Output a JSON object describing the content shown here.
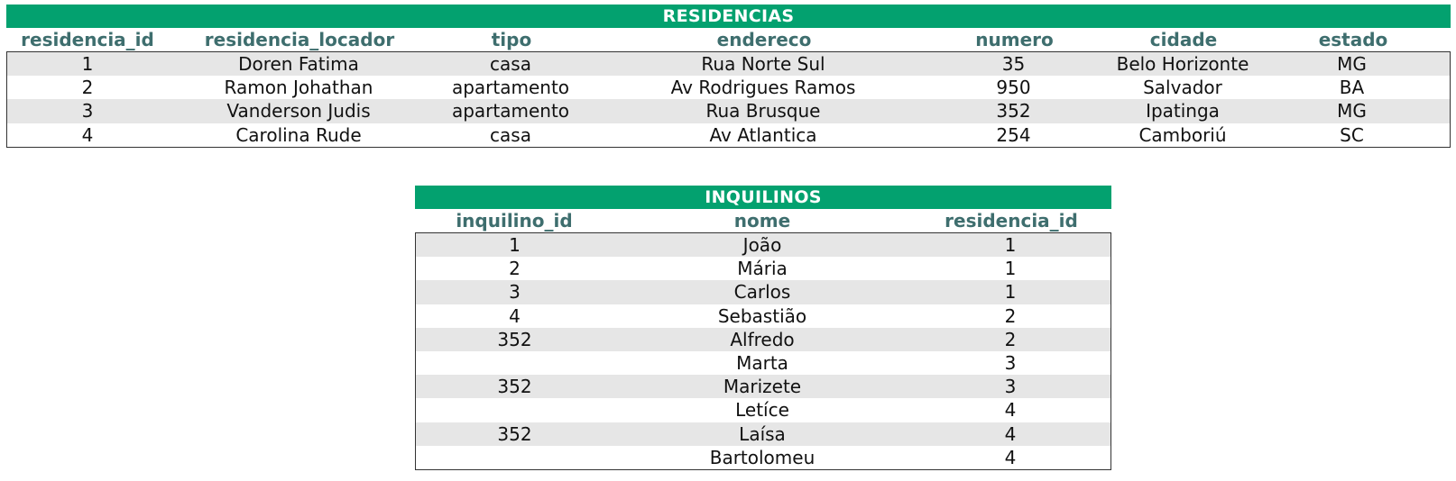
{
  "residencias": {
    "title": "RESIDENCIAS",
    "columns": [
      "residencia_id",
      "residencia_locador",
      "tipo",
      "endereco",
      "numero",
      "cidade",
      "estado"
    ],
    "rows": [
      [
        "1",
        "Doren Fatima",
        "casa",
        "Rua Norte Sul",
        "35",
        "Belo Horizonte",
        "MG"
      ],
      [
        "2",
        "Ramon Johathan",
        "apartamento",
        "Av Rodrigues Ramos",
        "950",
        "Salvador",
        "BA"
      ],
      [
        "3",
        "Vanderson Judis",
        "apartamento",
        "Rua Brusque",
        "352",
        "Ipatinga",
        "MG"
      ],
      [
        "4",
        "Carolina Rude",
        "casa",
        "Av Atlantica",
        "254",
        "Camboriú",
        "SC"
      ]
    ]
  },
  "inquilinos": {
    "title": "INQUILINOS",
    "columns": [
      "inquilino_id",
      "nome",
      "residencia_id"
    ],
    "rows": [
      [
        "1",
        "João",
        "1"
      ],
      [
        "2",
        "Mária",
        "1"
      ],
      [
        "3",
        "Carlos",
        "1"
      ],
      [
        "4",
        "Sebastião",
        "2"
      ],
      [
        "352",
        "Alfredo",
        "2"
      ],
      [
        "",
        "Marta",
        "3"
      ],
      [
        "352",
        "Marizete",
        "3"
      ],
      [
        "",
        "Letíce",
        "4"
      ],
      [
        "352",
        "Laísa",
        "4"
      ],
      [
        "",
        "Bartolomeu",
        "4"
      ]
    ]
  }
}
